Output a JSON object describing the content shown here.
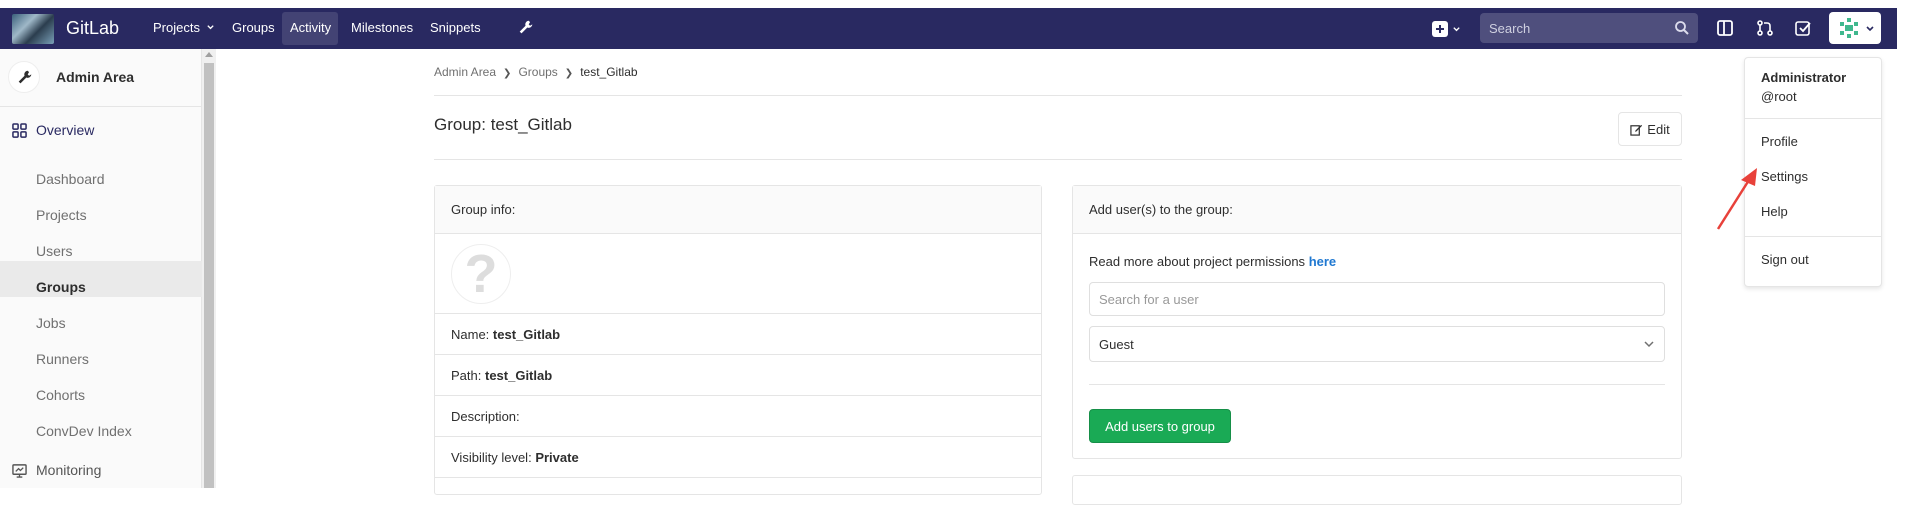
{
  "topnav": {
    "brand": "GitLab",
    "items": [
      "Projects",
      "Groups",
      "Activity",
      "Milestones",
      "Snippets"
    ],
    "search_placeholder": "Search"
  },
  "sidebar": {
    "title": "Admin Area",
    "overview": "Overview",
    "items": [
      "Dashboard",
      "Projects",
      "Users",
      "Groups",
      "Jobs",
      "Runners",
      "Cohorts",
      "ConvDev Index"
    ],
    "active": "Groups",
    "monitoring": "Monitoring"
  },
  "breadcrumb": [
    "Admin Area",
    "Groups",
    "test_Gitlab"
  ],
  "page_title": "Group: test_Gitlab",
  "edit_label": "Edit",
  "group_info": {
    "header": "Group info:",
    "name_label": "Name:",
    "name_value": "test_Gitlab",
    "path_label": "Path:",
    "path_value": "test_Gitlab",
    "description_label": "Description:",
    "visibility_label": "Visibility level:",
    "visibility_value": "Private"
  },
  "add_users": {
    "header": "Add user(s) to the group:",
    "permissions_text": "Read more about project permissions",
    "permissions_link": "here",
    "search_placeholder": "Search for a user",
    "role_value": "Guest",
    "button_label": "Add users to group"
  },
  "user_menu": {
    "name": "Administrator",
    "username": "@root",
    "items": [
      "Profile",
      "Settings",
      "Help"
    ],
    "sign_out": "Sign out"
  },
  "colors": {
    "nav_bg": "#292961",
    "accent_green": "#1aaa55",
    "link_blue": "#1f78d1"
  }
}
